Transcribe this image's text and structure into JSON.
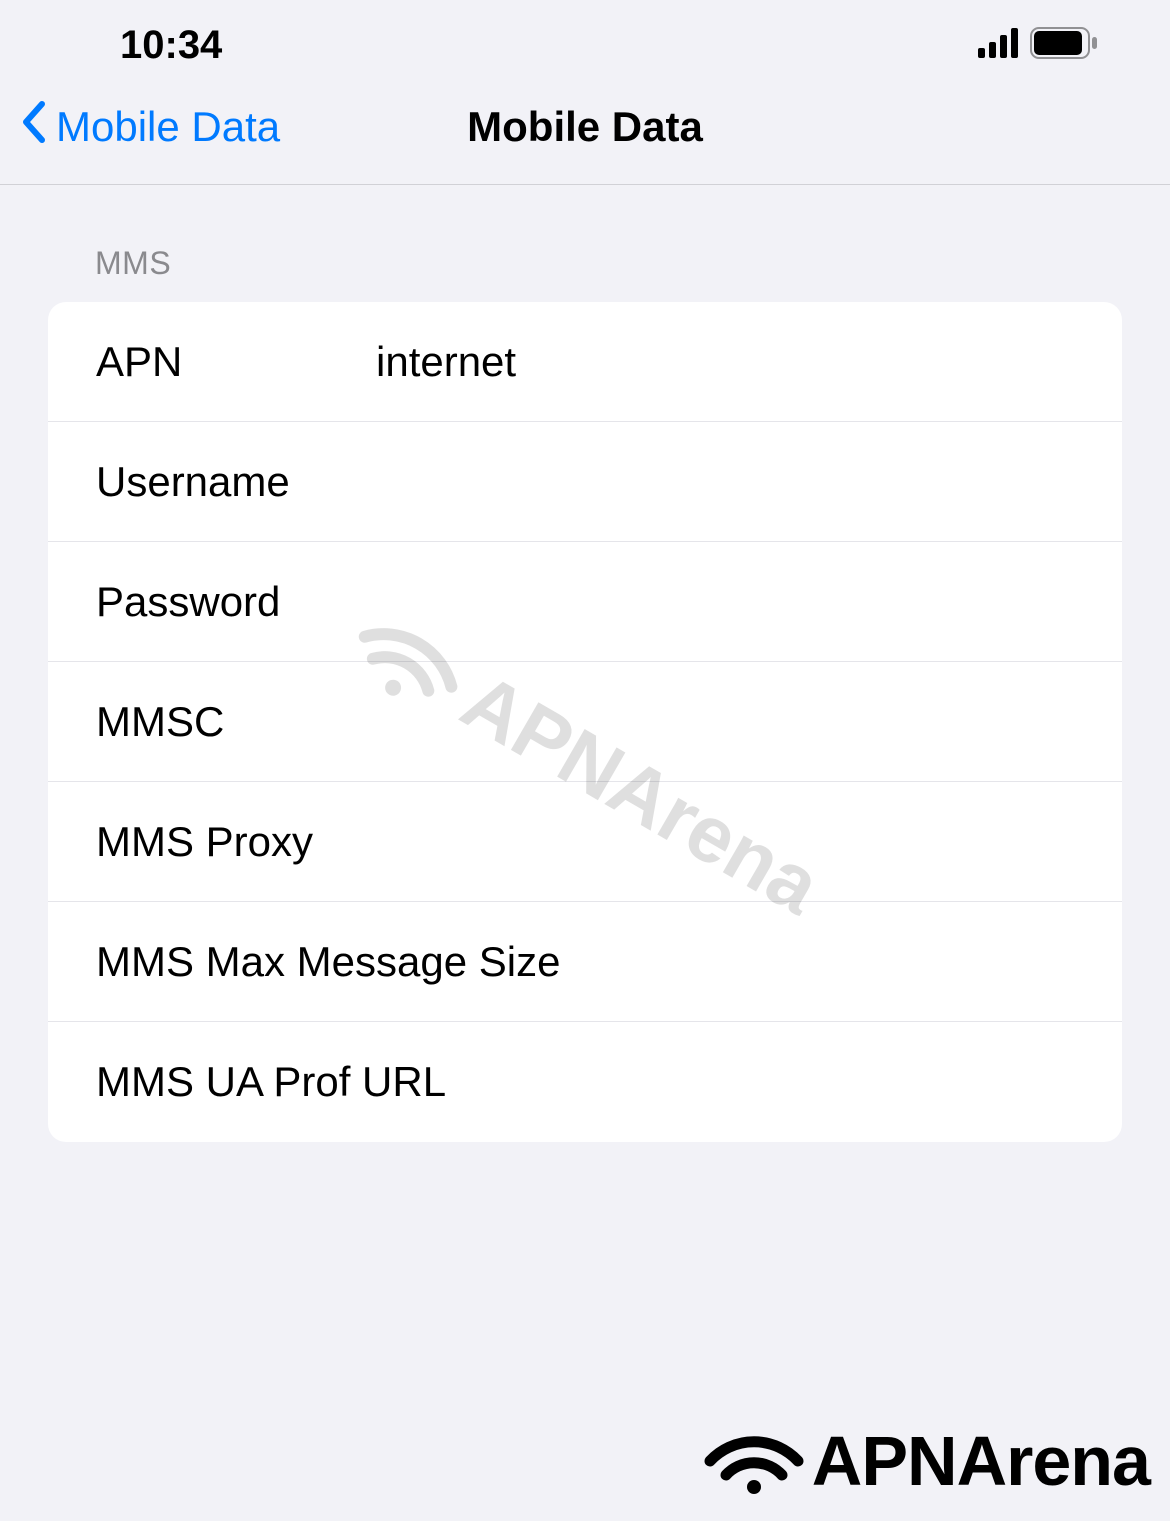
{
  "status_bar": {
    "time": "10:34"
  },
  "nav": {
    "back_label": "Mobile Data",
    "title": "Mobile Data"
  },
  "section": {
    "header": "MMS",
    "rows": [
      {
        "label": "APN",
        "value": "internet",
        "wide": false
      },
      {
        "label": "Username",
        "value": "",
        "wide": false
      },
      {
        "label": "Password",
        "value": "",
        "wide": false
      },
      {
        "label": "MMSC",
        "value": "",
        "wide": false
      },
      {
        "label": "MMS Proxy",
        "value": "",
        "wide": false
      },
      {
        "label": "MMS Max Message Size",
        "value": "",
        "wide": true
      },
      {
        "label": "MMS UA Prof URL",
        "value": "",
        "wide": true
      }
    ]
  },
  "watermark": "APNArena",
  "footer": "APNArena"
}
